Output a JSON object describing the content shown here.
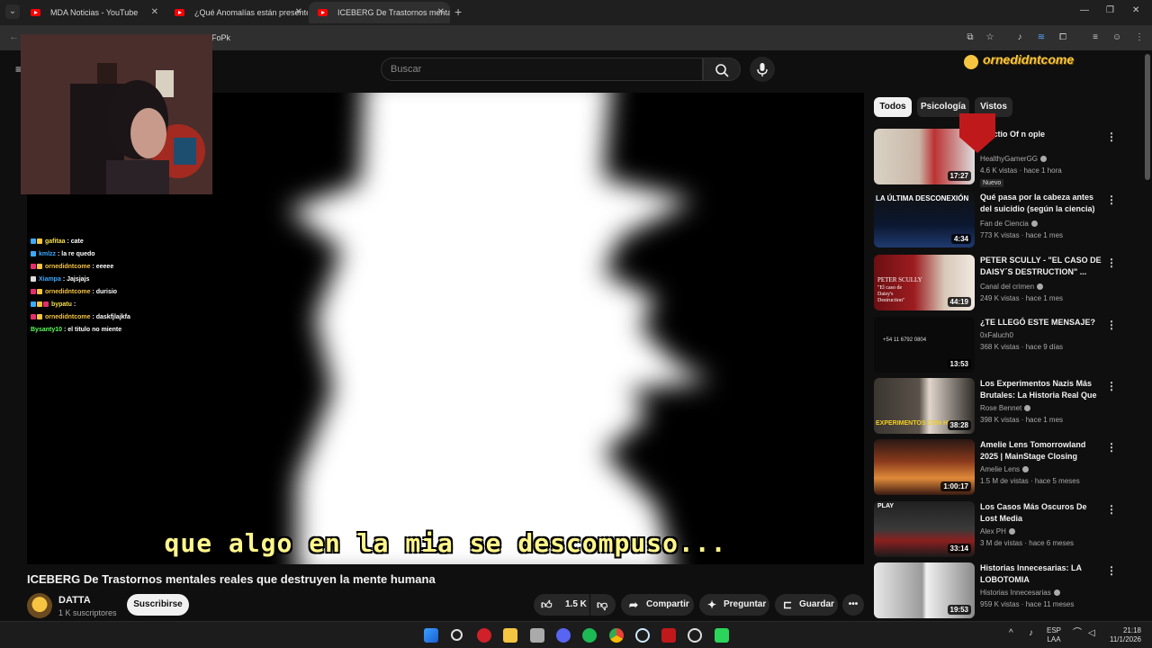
{
  "browser": {
    "tabs": [
      {
        "title": "MDA Noticias - YouTube"
      },
      {
        "title": "¿Qué Anomalías están presente"
      },
      {
        "title": "ICEBERG De Trastornos mentales"
      }
    ],
    "url_fragment": "FoPk"
  },
  "header": {
    "search_placeholder": "Buscar"
  },
  "overlay": {
    "streamer_name": "ornedidntcome"
  },
  "chat": [
    {
      "user": "gafitaa",
      "msg": ": cate",
      "color": "#f5e14a"
    },
    {
      "user": "kmlzz",
      "msg": ": la re quedo",
      "color": "#3da9ff"
    },
    {
      "user": "ornedidntcome",
      "msg": ": eeeee",
      "color": "#f5c542"
    },
    {
      "user": "Xiampa",
      "msg": ": Jajsjajs",
      "color": "#3da9ff"
    },
    {
      "user": "ornedidntcome",
      "msg": ": durisio",
      "color": "#f5c542"
    },
    {
      "user": "bypatu",
      "msg": ":",
      "color": "#f5e14a"
    },
    {
      "user": "ornedidntcome",
      "msg": ": daskfjlajkfa",
      "color": "#f5c542"
    },
    {
      "user": "Bysanty10",
      "msg": ": el titulo no miente",
      "color": "#5cff5c"
    }
  ],
  "video": {
    "subtitle": "que algo en la mia se descompuso...",
    "title": "ICEBERG De Trastornos mentales reales que destruyen la mente humana",
    "channel": "DATTA",
    "subscribers": "1 K suscriptores",
    "subscribe_label": "Suscribirse",
    "likes": "1.5 K",
    "share_label": "Compartir",
    "ask_label": "Preguntar",
    "save_label": "Guardar"
  },
  "chips": [
    "Todos",
    "Psicología",
    "Vistos"
  ],
  "recommendations": [
    {
      "title": "Ad   ctio  Of      n  ople",
      "channel": "HealthyGamerGG",
      "meta": "4.6 K vistas · hace 1 hora",
      "duration": "17:27",
      "badge": "Nuevo"
    },
    {
      "title": "Qué pasa por la cabeza antes del suicidio (según la ciencia)",
      "channel": "Fan de Ciencia",
      "meta": "773 K vistas · hace 1 mes",
      "duration": "4:34"
    },
    {
      "title": "PETER SCULLY - \"EL CASO DE DAISY´S DESTRUCTION\" ...",
      "channel": "Canal del crimen",
      "meta": "249 K vistas · hace 1 mes",
      "duration": "44:19"
    },
    {
      "title": "¿TE LLEGÓ ESTE MENSAJE?",
      "channel": "0xFaluch0",
      "meta": "368 K vistas · hace 9 días",
      "duration": "13:53"
    },
    {
      "title": "Los Experimentos Nazis Más Brutales: La Historia Real Que ...",
      "channel": "Rose Bennet",
      "meta": "398 K vistas · hace 1 mes",
      "duration": "38:28"
    },
    {
      "title": "Amelie Lens Tomorrowland 2025 | MainStage Closing",
      "channel": "Amelie Lens",
      "meta": "1.5 M de vistas · hace 5 meses",
      "duration": "1:00:17"
    },
    {
      "title": "Los Casos Más Oscuros De Lost Media",
      "channel": "Alex PH",
      "meta": "3 M de vistas · hace 6 meses",
      "duration": "33:14"
    },
    {
      "title": "Historias Innecesarias: LA LOBOTOMIA",
      "channel": "Historias Innecesarias",
      "meta": "959 K vistas · hace 11 meses",
      "duration": "19:53"
    }
  ],
  "thumb_texts": {
    "rec2": "LA ÚLTIMA DESCONEXIÓN",
    "rec3": "PETER SCULLY",
    "rec3b": "\"El caso de Daisy's Destruction\"",
    "rec4": "+54 11 6792 0804",
    "rec5": "EXPERIMENTOS CON HU",
    "rec7": "PLAY"
  },
  "taskbar": {
    "lang_top": "ESP",
    "lang_bottom": "LAA",
    "time": "21:18",
    "date": "11/1/2026"
  }
}
